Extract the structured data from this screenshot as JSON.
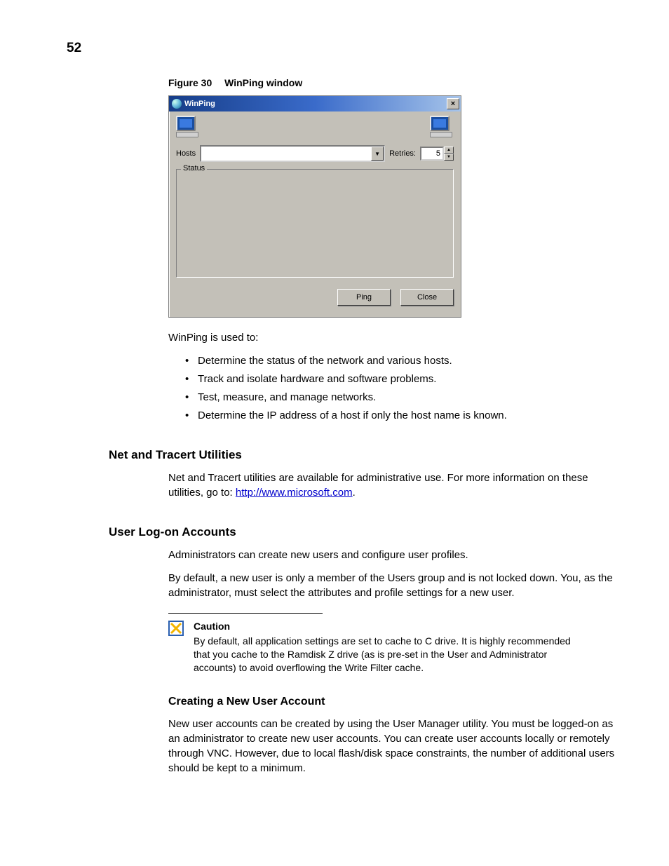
{
  "page_number": "52",
  "figure": {
    "label": "Figure 30",
    "title": "WinPing window"
  },
  "winping": {
    "title": "WinPing",
    "close_symbol": "×",
    "hosts_label": "Hosts",
    "hosts_value": "",
    "retries_label": "Retries:",
    "retries_value": "5",
    "status_label": "Status",
    "ping_button": "Ping",
    "close_button": "Close"
  },
  "intro_line": "WinPing is used to:",
  "bullets": [
    "Determine the status of the network and various hosts.",
    "Track and isolate hardware and software problems.",
    "Test, measure, and manage networks.",
    "Determine the IP address of a host if only the host name is known."
  ],
  "section_net": {
    "heading": "Net and Tracert Utilities",
    "text_before_link": "Net and Tracert utilities are available for administrative use. For more information on these utilities, go to: ",
    "link_text": "http://www.microsoft.com",
    "text_after_link": "."
  },
  "section_user": {
    "heading": "User Log-on Accounts",
    "p1": "Administrators can create new users and configure user profiles.",
    "p2": "By default, a new user is only a member of the Users group and is not locked down. You, as the administrator, must select the attributes and profile settings for a new user."
  },
  "caution": {
    "title": "Caution",
    "body": "By default, all application settings are set to cache to C drive. It is highly recommended that you cache to the Ramdisk Z drive (as is pre-set in the User and Administrator accounts) to avoid overflowing the Write Filter cache."
  },
  "section_create": {
    "heading": "Creating a New User Account",
    "p1": "New user accounts can be created by using the User Manager utility. You must be logged-on as an administrator to create new user accounts. You can create user accounts locally or remotely through VNC. However, due to local flash/disk space constraints, the number of additional users should be kept to a minimum."
  }
}
